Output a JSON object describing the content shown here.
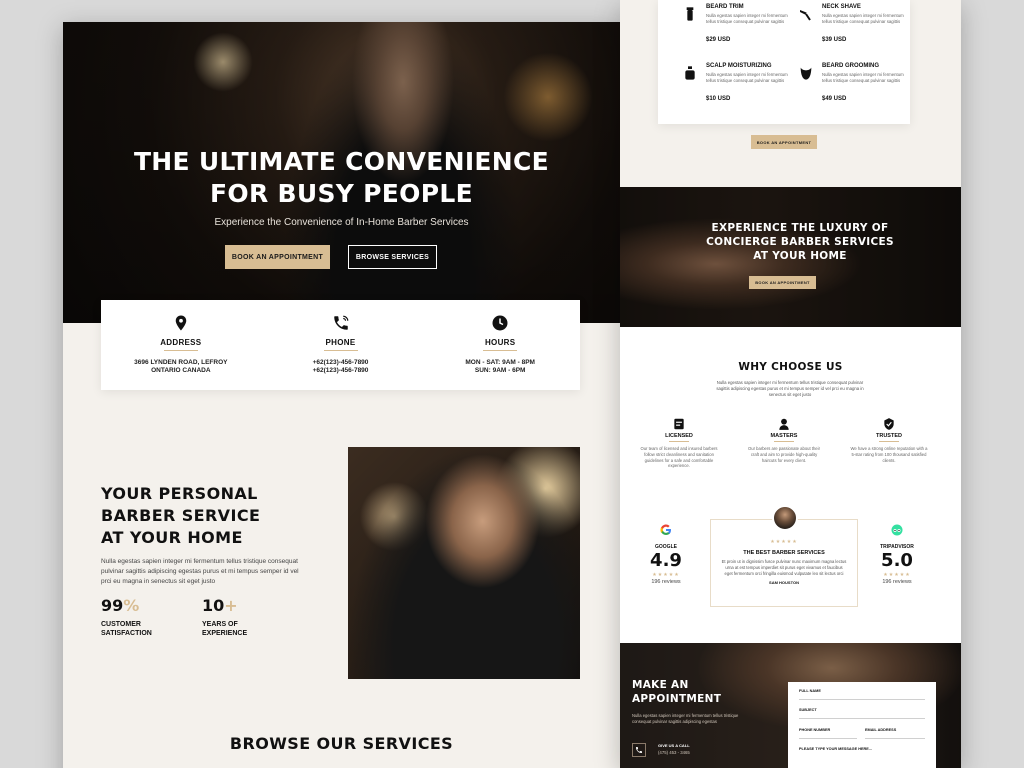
{
  "hero": {
    "title_line1": "THE ULTIMATE CONVENIENCE",
    "title_line2": "FOR BUSY PEOPLE",
    "subtitle": "Experience the Convenience of In-Home Barber Services",
    "book_btn": "BOOK AN APPOINTMENT",
    "browse_btn": "BROWSE SERVICES"
  },
  "info": {
    "address": {
      "title": "ADDRESS",
      "line1": "3696 LYNDEN ROAD, LEFROY",
      "line2": "ONTARIO CANADA",
      "icon": "map-pin-icon"
    },
    "phone": {
      "title": "PHONE",
      "line1": "+62(123)-456-7890",
      "line2": "+62(123)-456-7890",
      "icon": "phone-icon"
    },
    "hours": {
      "title": "HOURS",
      "line1": "MON - SAT: 9AM - 8PM",
      "line2": "SUN: 9AM - 6PM",
      "icon": "clock-icon"
    }
  },
  "about": {
    "title_line1": "YOUR PERSONAL",
    "title_line2": "BARBER SERVICE",
    "title_line3": "AT YOUR HOME",
    "text": "Nulla egestas sapien integer mi fermentum tellus tristique consequat pulvinar sagittis adipiscing egestas purus et mi tempus semper id vel prci eu magna in senectus sit eget justo",
    "stat1": {
      "value": "99",
      "suffix": "%",
      "label1": "CUSTOMER",
      "label2": "SATISFACTION"
    },
    "stat2": {
      "value": "10",
      "suffix": "+",
      "label1": "YEARS OF",
      "label2": "EXPERIENCE"
    }
  },
  "browse": {
    "title": "BROWSE OUR SERVICES"
  },
  "services": {
    "items": [
      {
        "name": "BEARD TRIM",
        "desc": "Nulla egestas sapien integer mi fermentum tellus tristique consequat pulvinar sagittis",
        "price": "$29 USD",
        "icon": "trimmer-icon"
      },
      {
        "name": "NECK SHAVE",
        "desc": "Nulla egestas sapien integer mi fermentum tellus tristique consequat pulvinar sagittis",
        "price": "$39 USD",
        "icon": "razor-icon"
      },
      {
        "name": "SCALP MOISTURIZING",
        "desc": "Nulla egestas sapien integer mi fermentum tellus tristique consequat pulvinar sagittis",
        "price": "$10 USD",
        "icon": "bottle-icon"
      },
      {
        "name": "BEARD GROOMING",
        "desc": "Nulla egestas sapien integer mi fermentum tellus tristique consequat pulvinar sagittis",
        "price": "$49 USD",
        "icon": "beard-icon"
      }
    ],
    "book_btn": "BOOK AN APPOINTMENT"
  },
  "luxury": {
    "line1": "EXPERIENCE THE LUXURY OF",
    "line2": "CONCIERGE BARBER SERVICES",
    "line3": "AT YOUR HOME",
    "book_btn": "BOOK AN APPOINTMENT"
  },
  "why": {
    "title": "WHY CHOOSE US",
    "text": "Nulla egestas sapien integer mi fermentum tellus tristique consequat pulvinar sagittis adipiscing egestas purus et mi tempus semper id vel prci eu magna in senectus sit eget justo",
    "features": [
      {
        "title": "LICENSED",
        "desc": "Our team of licensed and insured barbers follow strict cleanliness and sanitation guidelines for a safe and comfortable experience.",
        "icon": "license-icon"
      },
      {
        "title": "MASTERS",
        "desc": "Our barbers are passionate about their craft and aim to provide high-quality haircuts for every client.",
        "icon": "barber-icon"
      },
      {
        "title": "TRUSTED",
        "desc": "We have a strong online reputation with a 5-star rating from 100 thousand satisfied clients.",
        "icon": "shield-check-icon"
      }
    ]
  },
  "ratings": {
    "google": {
      "source": "GOOGLE",
      "value": "4.9",
      "stars": "★★★★★",
      "reviews": "196 reviews",
      "icon": "google-icon"
    },
    "tripadvisor": {
      "source": "TRIPADVISOR",
      "value": "5.0",
      "stars": "★★★★★",
      "reviews": "196 reviews",
      "icon": "tripadvisor-icon"
    },
    "review": {
      "stars": "★★★★★",
      "title": "THE BEST BARBER SERVICES",
      "text": "Et proin ut in dignissim fusce pulvinar nunc maximum magna lectus urna at est tempus imperdiet sit purus eget vivamus et faucibus eget fermentum orci fringilla euismod vulputate leo sit lectus orci",
      "name": "SAM HOUSTON"
    }
  },
  "appointment": {
    "title_line1": "MAKE AN",
    "title_line2": "APPOINTMENT",
    "text": "Nulla egestas sapien integer mi fermentum tellus tristique consequat pulvinar sagittis adipiscing egestas",
    "call_label": "GIVE US A CALL",
    "call_number": "(475) 453 - 3465",
    "form": {
      "full_name": "FULL NAME",
      "subject": "SUBJECT",
      "phone": "PHONE NUMBER",
      "email": "EMAIL ADDRESS",
      "message": "PLEASE TYPE YOUR MESSAGE HERE..."
    }
  },
  "colors": {
    "accent": "#d8bd93",
    "dark": "#111111",
    "background": "#f4f1ec"
  }
}
